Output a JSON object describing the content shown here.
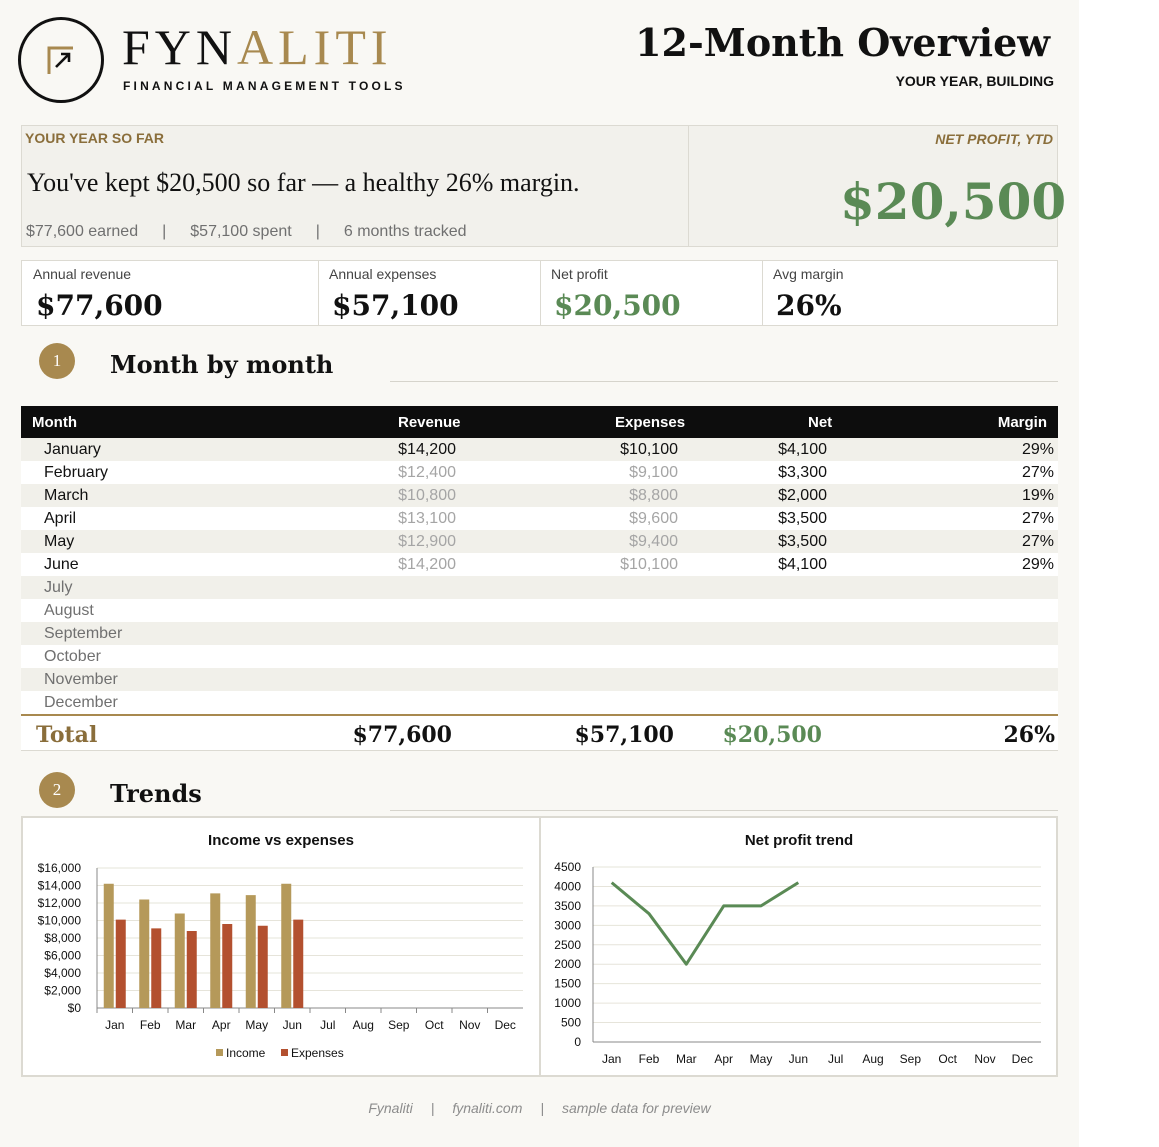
{
  "brand": {
    "name_dark": "FYN",
    "name_gold": "ALITI",
    "tagline": "FINANCIAL MANAGEMENT TOOLS"
  },
  "header": {
    "title": "12-Month Overview",
    "subtitle": "YOUR YEAR, BUILDING"
  },
  "banner": {
    "label": "YOUR YEAR SO FAR",
    "headline": "You've kept $20,500 so far — a healthy 26% margin.",
    "earned": "$77,600 earned",
    "spent": "$57,100 spent",
    "tracked": "6 months tracked",
    "separator": "|",
    "right_label": "NET PROFIT, YTD",
    "right_value": "$20,500"
  },
  "kpis": [
    {
      "label": "Annual revenue",
      "value": "$77,600"
    },
    {
      "label": "Annual expenses",
      "value": "$57,100"
    },
    {
      "label": "Net profit",
      "value": "$20,500"
    },
    {
      "label": "Avg margin",
      "value": "26%"
    }
  ],
  "sections": [
    {
      "number": "1",
      "title": "Month by month"
    },
    {
      "number": "2",
      "title": "Trends"
    }
  ],
  "table": {
    "headers": [
      "Month",
      "Revenue",
      "Expenses",
      "Net",
      "Margin"
    ],
    "rows": [
      {
        "month": "January",
        "revenue": "$14,200",
        "expenses": "$10,100",
        "net": "$4,100",
        "margin": "29%"
      },
      {
        "month": "February",
        "revenue": "$12,400",
        "expenses": "$9,100",
        "net": "$3,300",
        "margin": "27%"
      },
      {
        "month": "March",
        "revenue": "$10,800",
        "expenses": "$8,800",
        "net": "$2,000",
        "margin": "19%"
      },
      {
        "month": "April",
        "revenue": "$13,100",
        "expenses": "$9,600",
        "net": "$3,500",
        "margin": "27%"
      },
      {
        "month": "May",
        "revenue": "$12,900",
        "expenses": "$9,400",
        "net": "$3,500",
        "margin": "27%"
      },
      {
        "month": "June",
        "revenue": "$14,200",
        "expenses": "$10,100",
        "net": "$4,100",
        "margin": "29%"
      },
      {
        "month": "July",
        "revenue": "",
        "expenses": "",
        "net": "",
        "margin": ""
      },
      {
        "month": "August",
        "revenue": "",
        "expenses": "",
        "net": "",
        "margin": ""
      },
      {
        "month": "September",
        "revenue": "",
        "expenses": "",
        "net": "",
        "margin": ""
      },
      {
        "month": "October",
        "revenue": "",
        "expenses": "",
        "net": "",
        "margin": ""
      },
      {
        "month": "November",
        "revenue": "",
        "expenses": "",
        "net": "",
        "margin": ""
      },
      {
        "month": "December",
        "revenue": "",
        "expenses": "",
        "net": "",
        "margin": ""
      }
    ],
    "total": {
      "label": "Total",
      "revenue": "$77,600",
      "expenses": "$57,100",
      "net": "$20,500",
      "margin": "26%"
    }
  },
  "colors": {
    "gold": "#a8894f",
    "income": "#b5995a",
    "expenses": "#b3502f",
    "net": "#5a8a55",
    "header": "#0d0d0d"
  },
  "chart_data": [
    {
      "type": "bar",
      "title": "Income vs expenses",
      "categories": [
        "Jan",
        "Feb",
        "Mar",
        "Apr",
        "May",
        "Jun",
        "Jul",
        "Aug",
        "Sep",
        "Oct",
        "Nov",
        "Dec"
      ],
      "series": [
        {
          "name": "Income",
          "values": [
            14200,
            12400,
            10800,
            13100,
            12900,
            14200,
            null,
            null,
            null,
            null,
            null,
            null
          ]
        },
        {
          "name": "Expenses",
          "values": [
            10100,
            9100,
            8800,
            9600,
            9400,
            10100,
            null,
            null,
            null,
            null,
            null,
            null
          ]
        }
      ],
      "yticks": [
        "$0",
        "$2,000",
        "$4,000",
        "$6,000",
        "$8,000",
        "$10,000",
        "$12,000",
        "$14,000",
        "$16,000"
      ],
      "ylim": [
        0,
        16000
      ],
      "legend": "bottom",
      "grid": true
    },
    {
      "type": "line",
      "title": "Net profit trend",
      "categories": [
        "Jan",
        "Feb",
        "Mar",
        "Apr",
        "May",
        "Jun",
        "Jul",
        "Aug",
        "Sep",
        "Oct",
        "Nov",
        "Dec"
      ],
      "series": [
        {
          "values": [
            4100,
            3300,
            2000,
            3500,
            3500,
            4100,
            null,
            null,
            null,
            null,
            null,
            null
          ]
        }
      ],
      "yticks": [
        "0",
        "500",
        "1000",
        "1500",
        "2000",
        "2500",
        "3000",
        "3500",
        "4000",
        "4500"
      ],
      "ylim": [
        0,
        4500
      ],
      "grid": true
    }
  ],
  "footer": {
    "brand": "Fynaliti",
    "site": "fynaliti.com",
    "note": "sample data for preview",
    "separator": "|"
  }
}
